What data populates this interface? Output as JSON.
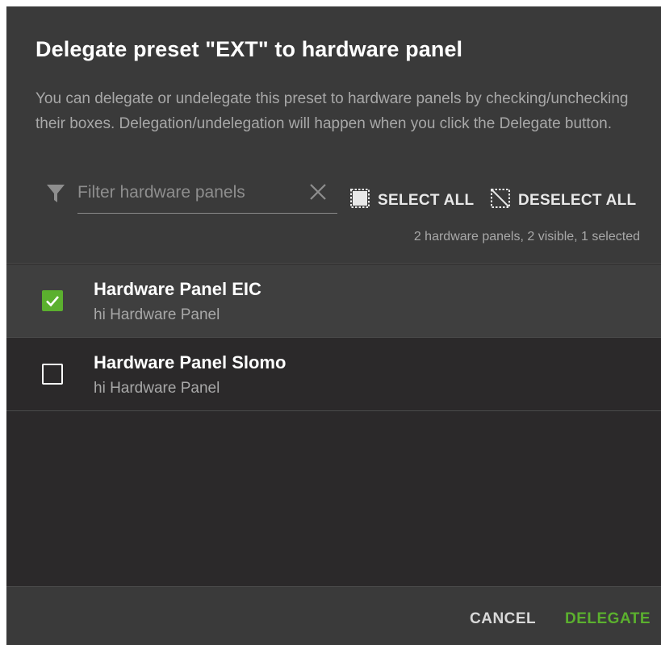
{
  "dialog": {
    "title": "Delegate preset \"EXT\" to hardware panel",
    "description": "You can delegate or undelegate this preset to hardware panels by checking/unchecking their boxes. Delegation/undelegation will happen when you click the Delegate button."
  },
  "filter": {
    "placeholder": "Filter hardware panels",
    "value": ""
  },
  "actions": {
    "select_all": "SELECT ALL",
    "deselect_all": "DESELECT ALL"
  },
  "status": "2 hardware panels, 2 visible, 1 selected",
  "panels": [
    {
      "title": "Hardware Panel EIC",
      "subtitle": "hi Hardware Panel",
      "checked": true
    },
    {
      "title": "Hardware Panel Slomo",
      "subtitle": "hi Hardware Panel",
      "checked": false
    }
  ],
  "footer": {
    "cancel": "CANCEL",
    "delegate": "DELEGATE"
  },
  "colors": {
    "accent": "#5bb02e",
    "dialog_bg": "#2b292a",
    "header_bg": "#3a3a3a"
  },
  "icons": {
    "filter": "filter-icon",
    "clear": "close-icon",
    "select_all": "select-all-icon",
    "deselect_all": "deselect-all-icon",
    "check": "check-icon"
  }
}
